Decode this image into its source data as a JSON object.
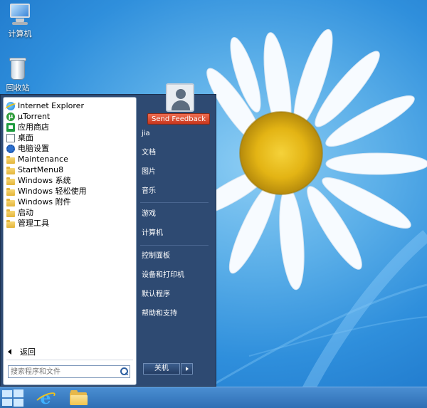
{
  "desktop": {
    "icons": [
      {
        "label": "计算机",
        "icon": "computer-icon"
      },
      {
        "label": "回收站",
        "icon": "recycle-bin-icon"
      }
    ]
  },
  "start_menu": {
    "programs": [
      {
        "label": "Internet Explorer",
        "icon": "ie-icon"
      },
      {
        "label": "μTorrent",
        "icon": "utorrent-icon"
      },
      {
        "label": "应用商店",
        "icon": "store-icon"
      },
      {
        "label": "桌面",
        "icon": "desktop-icon"
      },
      {
        "label": "电脑设置",
        "icon": "gear-icon"
      },
      {
        "label": "Maintenance",
        "icon": "folder-icon"
      },
      {
        "label": "StartMenu8",
        "icon": "folder-icon"
      },
      {
        "label": "Windows 系统",
        "icon": "folder-icon"
      },
      {
        "label": "Windows 轻松使用",
        "icon": "folder-icon"
      },
      {
        "label": "Windows 附件",
        "icon": "folder-icon"
      },
      {
        "label": "启动",
        "icon": "folder-icon"
      },
      {
        "label": "管理工具",
        "icon": "folder-icon"
      }
    ],
    "back_label": "返回",
    "search_placeholder": "搜索程序和文件",
    "feedback_label": "Send Feedback",
    "right_items": [
      {
        "label": "jia"
      },
      {
        "label": "文档"
      },
      {
        "label": "图片"
      },
      {
        "label": "音乐"
      },
      {
        "label": "游戏"
      },
      {
        "label": "计算机"
      },
      {
        "label": "控制面板"
      },
      {
        "label": "设备和打印机"
      },
      {
        "label": "默认程序"
      },
      {
        "label": "帮助和支持"
      }
    ],
    "shutdown_label": "关机"
  },
  "taskbar": {
    "items": [
      {
        "icon": "windows-start-icon"
      },
      {
        "icon": "internet-explorer-icon"
      },
      {
        "icon": "file-explorer-icon"
      }
    ]
  },
  "colors": {
    "menu_background": "#2e4a72",
    "feedback_button": "#d94a2c",
    "taskbar": "#3b7ec4"
  }
}
